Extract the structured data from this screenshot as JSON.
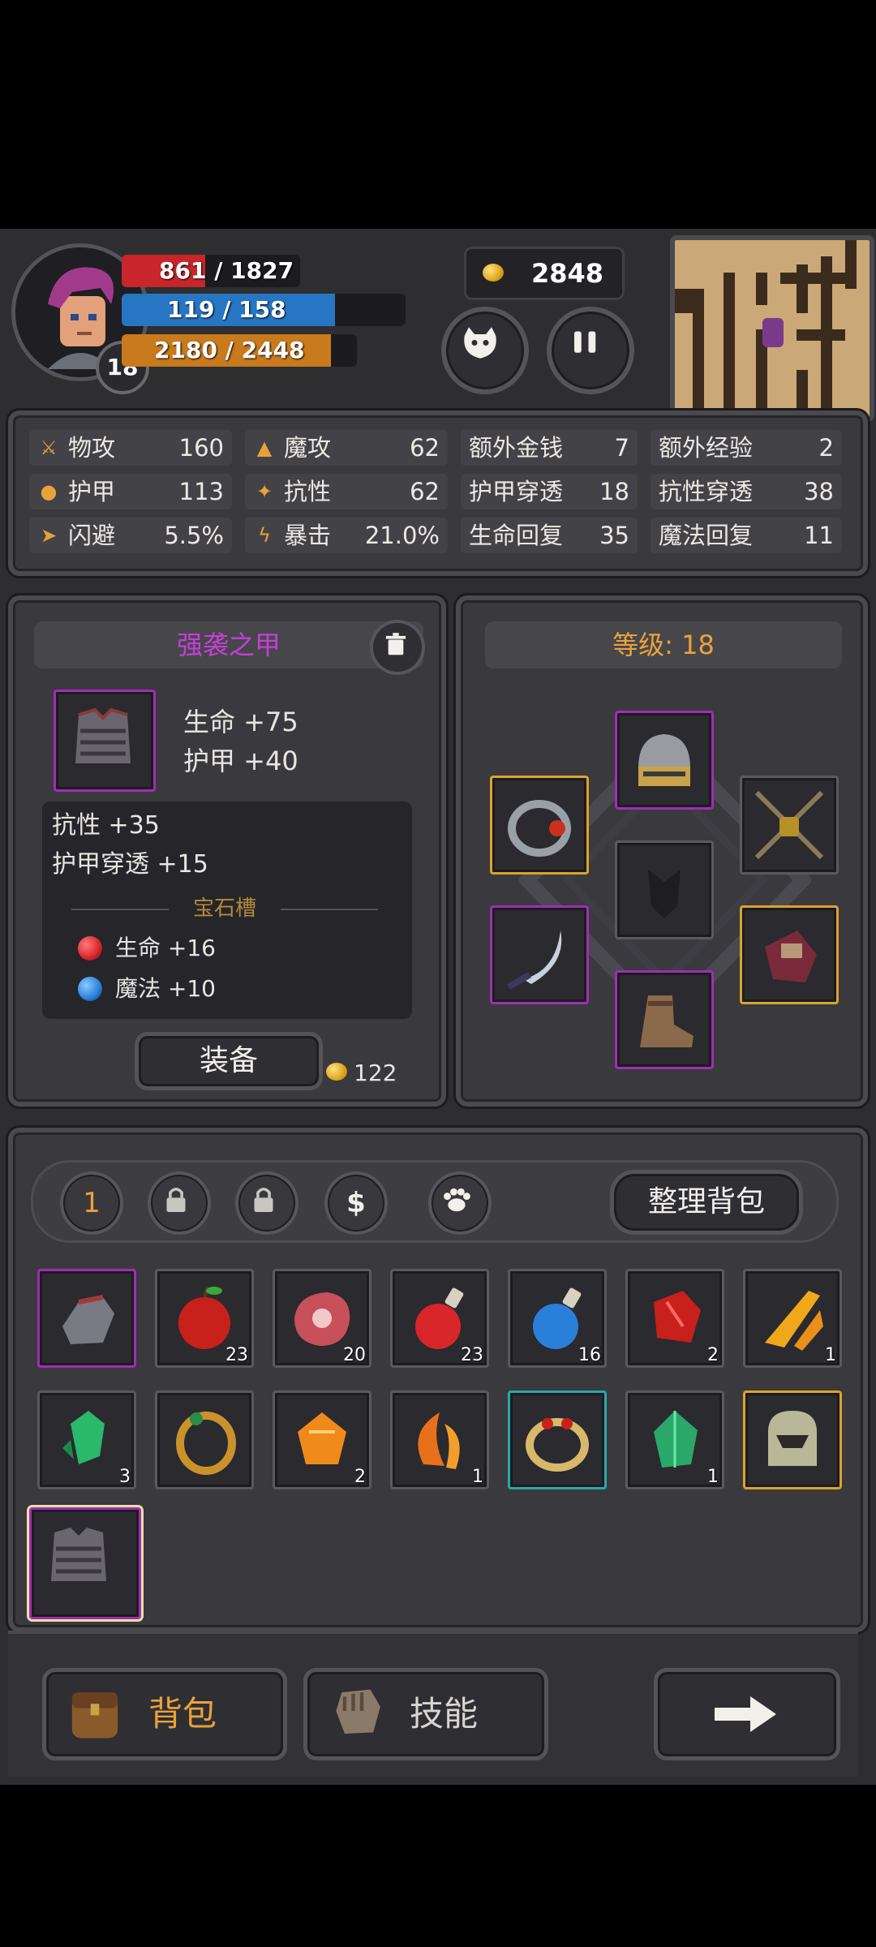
{
  "player": {
    "level": "18",
    "hp": "861 / 1827",
    "hp_fraction": 0.47,
    "mp": "119 / 158",
    "mp_fraction": 0.75,
    "exp": "2180 / 2448",
    "exp_fraction": 0.89,
    "gold": "2848"
  },
  "stats": [
    {
      "label": "物攻",
      "value": "160",
      "icon": "sword-icon"
    },
    {
      "label": "魔攻",
      "value": "62",
      "icon": "wizard-hat-icon"
    },
    {
      "label": "额外金钱",
      "value": "7"
    },
    {
      "label": "额外经验",
      "value": "2"
    },
    {
      "label": "护甲",
      "value": "113",
      "icon": "paw-icon"
    },
    {
      "label": "抗性",
      "value": "62",
      "icon": "muscle-icon"
    },
    {
      "label": "护甲穿透",
      "value": "18"
    },
    {
      "label": "抗性穿透",
      "value": "38"
    },
    {
      "label": "闪避",
      "value": "5.5%",
      "icon": "running-icon"
    },
    {
      "label": "暴击",
      "value": "21.0%",
      "icon": "lightning-icon"
    },
    {
      "label": "生命回复",
      "value": "35"
    },
    {
      "label": "魔法回复",
      "value": "11"
    }
  ],
  "item_detail": {
    "name": "强袭之甲",
    "main_stats": [
      "生命 +75",
      "护甲 +40"
    ],
    "sub_stats": [
      "抗性 +35",
      "护甲穿透 +15"
    ],
    "gem_title": "宝石槽",
    "gems": [
      {
        "text": "生命 +16",
        "color": "#d8262a"
      },
      {
        "text": "魔法 +10",
        "color": "#2a7fd8"
      }
    ],
    "equip_label": "装备",
    "price": "122"
  },
  "equipment": {
    "level_label": "等级: 18"
  },
  "bag": {
    "page_label": "1",
    "sort_label": "整理背包",
    "items": [
      {
        "name": "gauntlet",
        "count": "",
        "rarity": "purple"
      },
      {
        "name": "apple",
        "count": "23",
        "rarity": "none"
      },
      {
        "name": "meat",
        "count": "20",
        "rarity": "none"
      },
      {
        "name": "red-potion",
        "count": "23",
        "rarity": "none"
      },
      {
        "name": "blue-potion",
        "count": "16",
        "rarity": "none"
      },
      {
        "name": "red-gem",
        "count": "2",
        "rarity": "none"
      },
      {
        "name": "gold-shard",
        "count": "1",
        "rarity": "none"
      },
      {
        "name": "green-crystal",
        "count": "3",
        "rarity": "none"
      },
      {
        "name": "gold-ring",
        "count": "",
        "rarity": "none"
      },
      {
        "name": "orange-gem",
        "count": "2",
        "rarity": "none"
      },
      {
        "name": "orange-horn",
        "count": "1",
        "rarity": "none"
      },
      {
        "name": "ruby-ring",
        "count": "",
        "rarity": "teal"
      },
      {
        "name": "green-gem",
        "count": "1",
        "rarity": "none"
      },
      {
        "name": "helmet",
        "count": "",
        "rarity": "gold"
      },
      {
        "name": "chest-armor",
        "count": "",
        "rarity": "purple"
      }
    ]
  },
  "bottom_nav": {
    "bag_label": "背包",
    "skill_label": "技能"
  },
  "colors": {
    "hp": "#c8262a",
    "mp": "#2776c4",
    "exp": "#c97a1c",
    "accent_gold": "#e8a23a",
    "purple_title": "#c63fd8"
  }
}
